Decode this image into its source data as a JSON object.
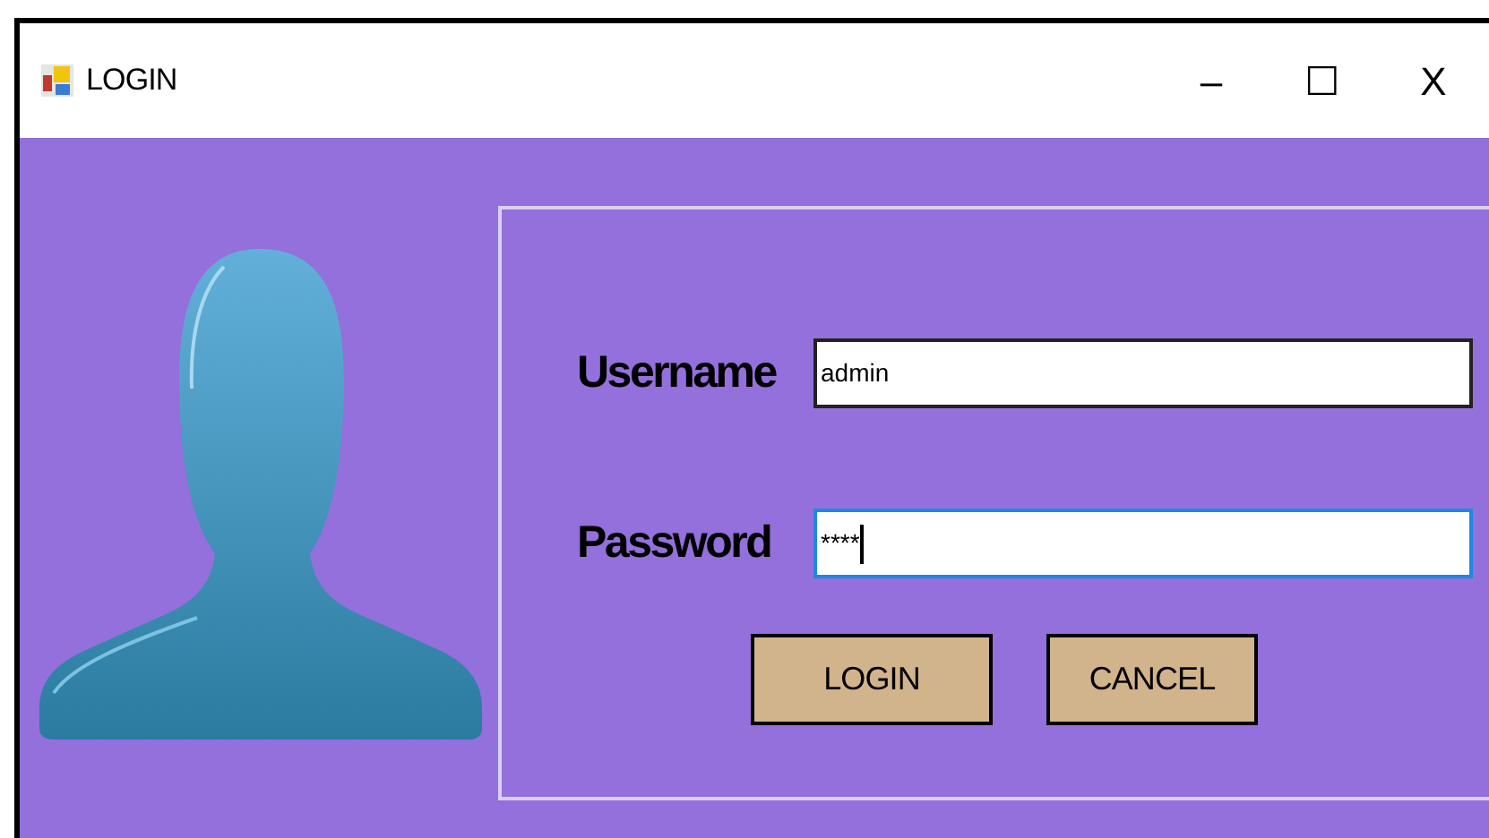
{
  "window": {
    "title": "LOGIN",
    "controls": [
      "–",
      "☐",
      "X"
    ]
  },
  "fields": [
    {
      "label": "Username",
      "value": "admin",
      "focused": false
    },
    {
      "label": "Password",
      "value": "****",
      "focused": true
    }
  ],
  "buttons": [
    "LOGIN",
    "CANCEL"
  ]
}
